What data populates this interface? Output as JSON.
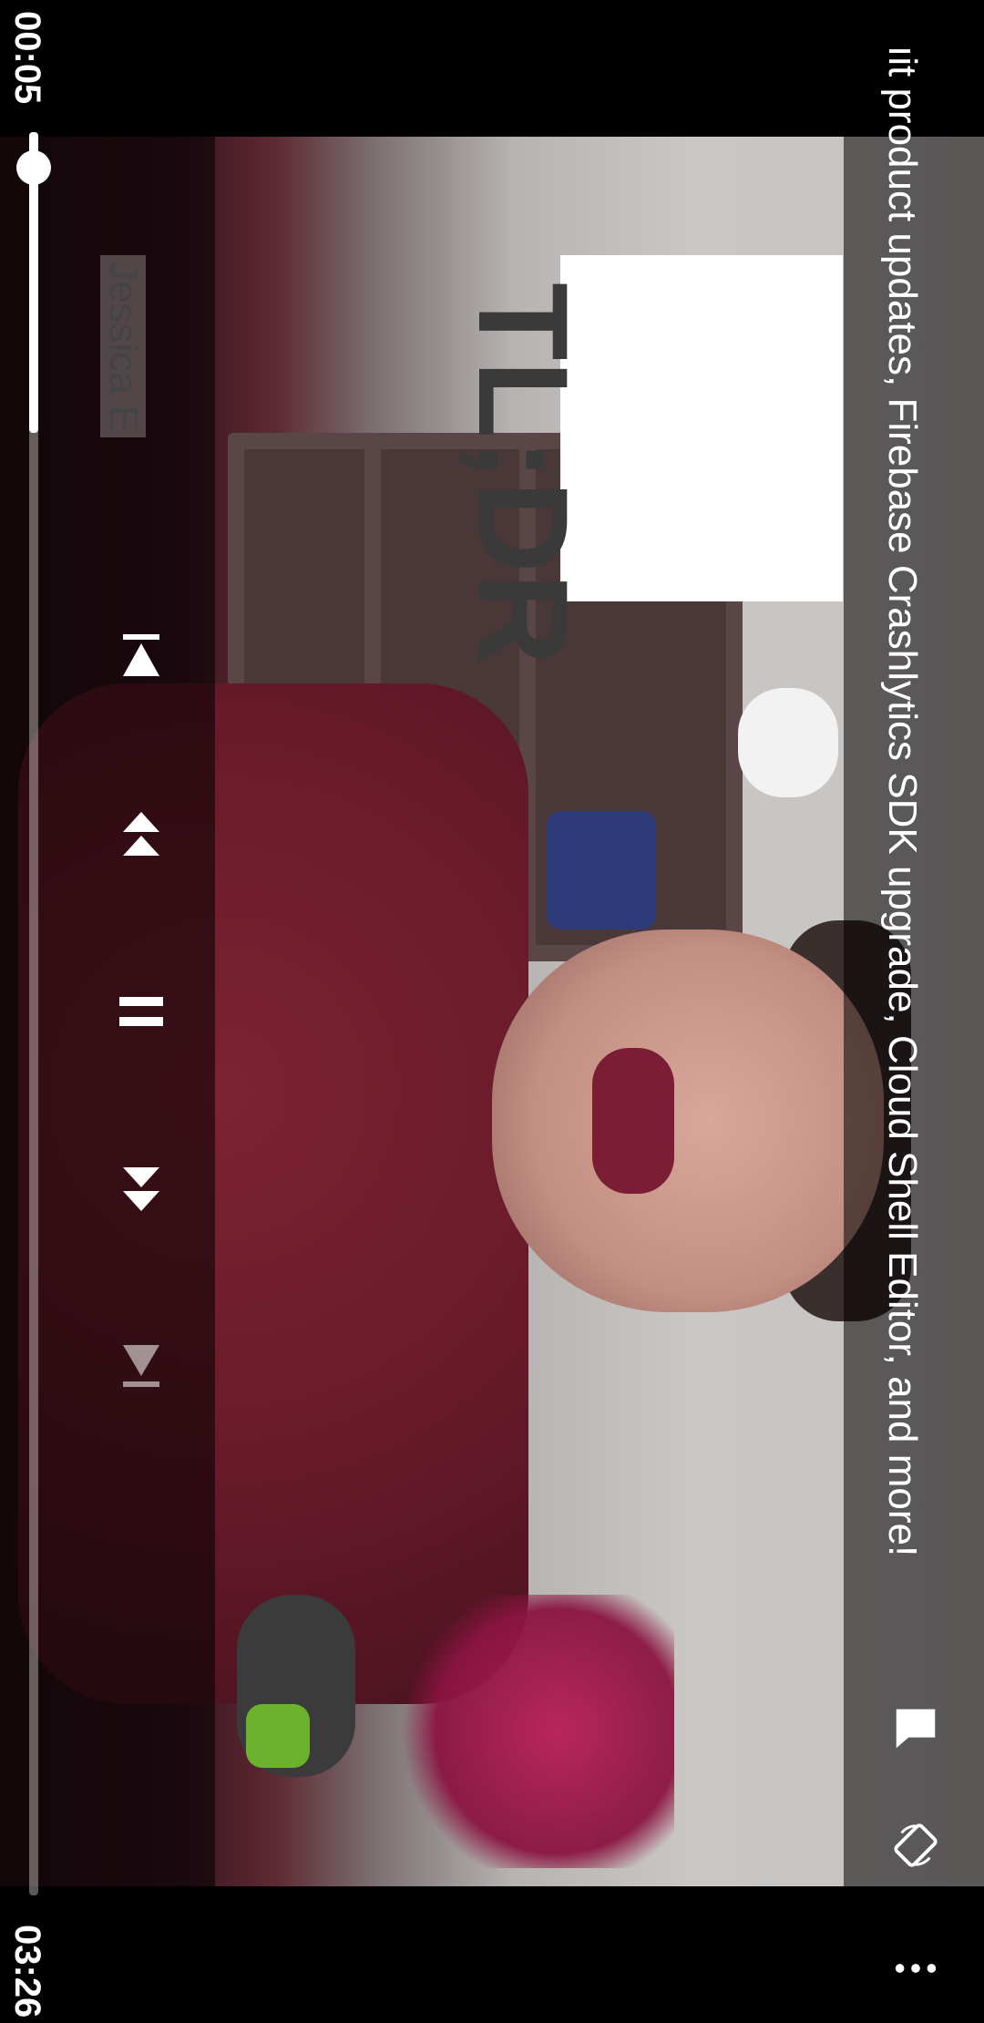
{
  "player": {
    "elapsed_time": "00:05",
    "duration_time": "03:26",
    "progress_fraction": 0.025
  },
  "video": {
    "title_text": "...it product updates, Firebase Crashlytics SDK upgrade, Cloud Shell Editor, and more!",
    "title_visible": "ıit product updates, Firebase Crashlytics SDK upgrade, Cloud Shell Editor, and more!",
    "lower_third_name": "Jessica E"
  },
  "controls": {
    "previous": "previous-icon",
    "rewind": "rewind-icon",
    "pause": "pause-icon",
    "fast_forward": "fast-forward-icon",
    "next": "next-icon"
  },
  "right_icons": {
    "captions": "captions-icon",
    "rotate": "rotate-icon",
    "more": "more-options-icon"
  },
  "colors": {
    "accent": "#ffffff",
    "overlay": "#000000"
  }
}
